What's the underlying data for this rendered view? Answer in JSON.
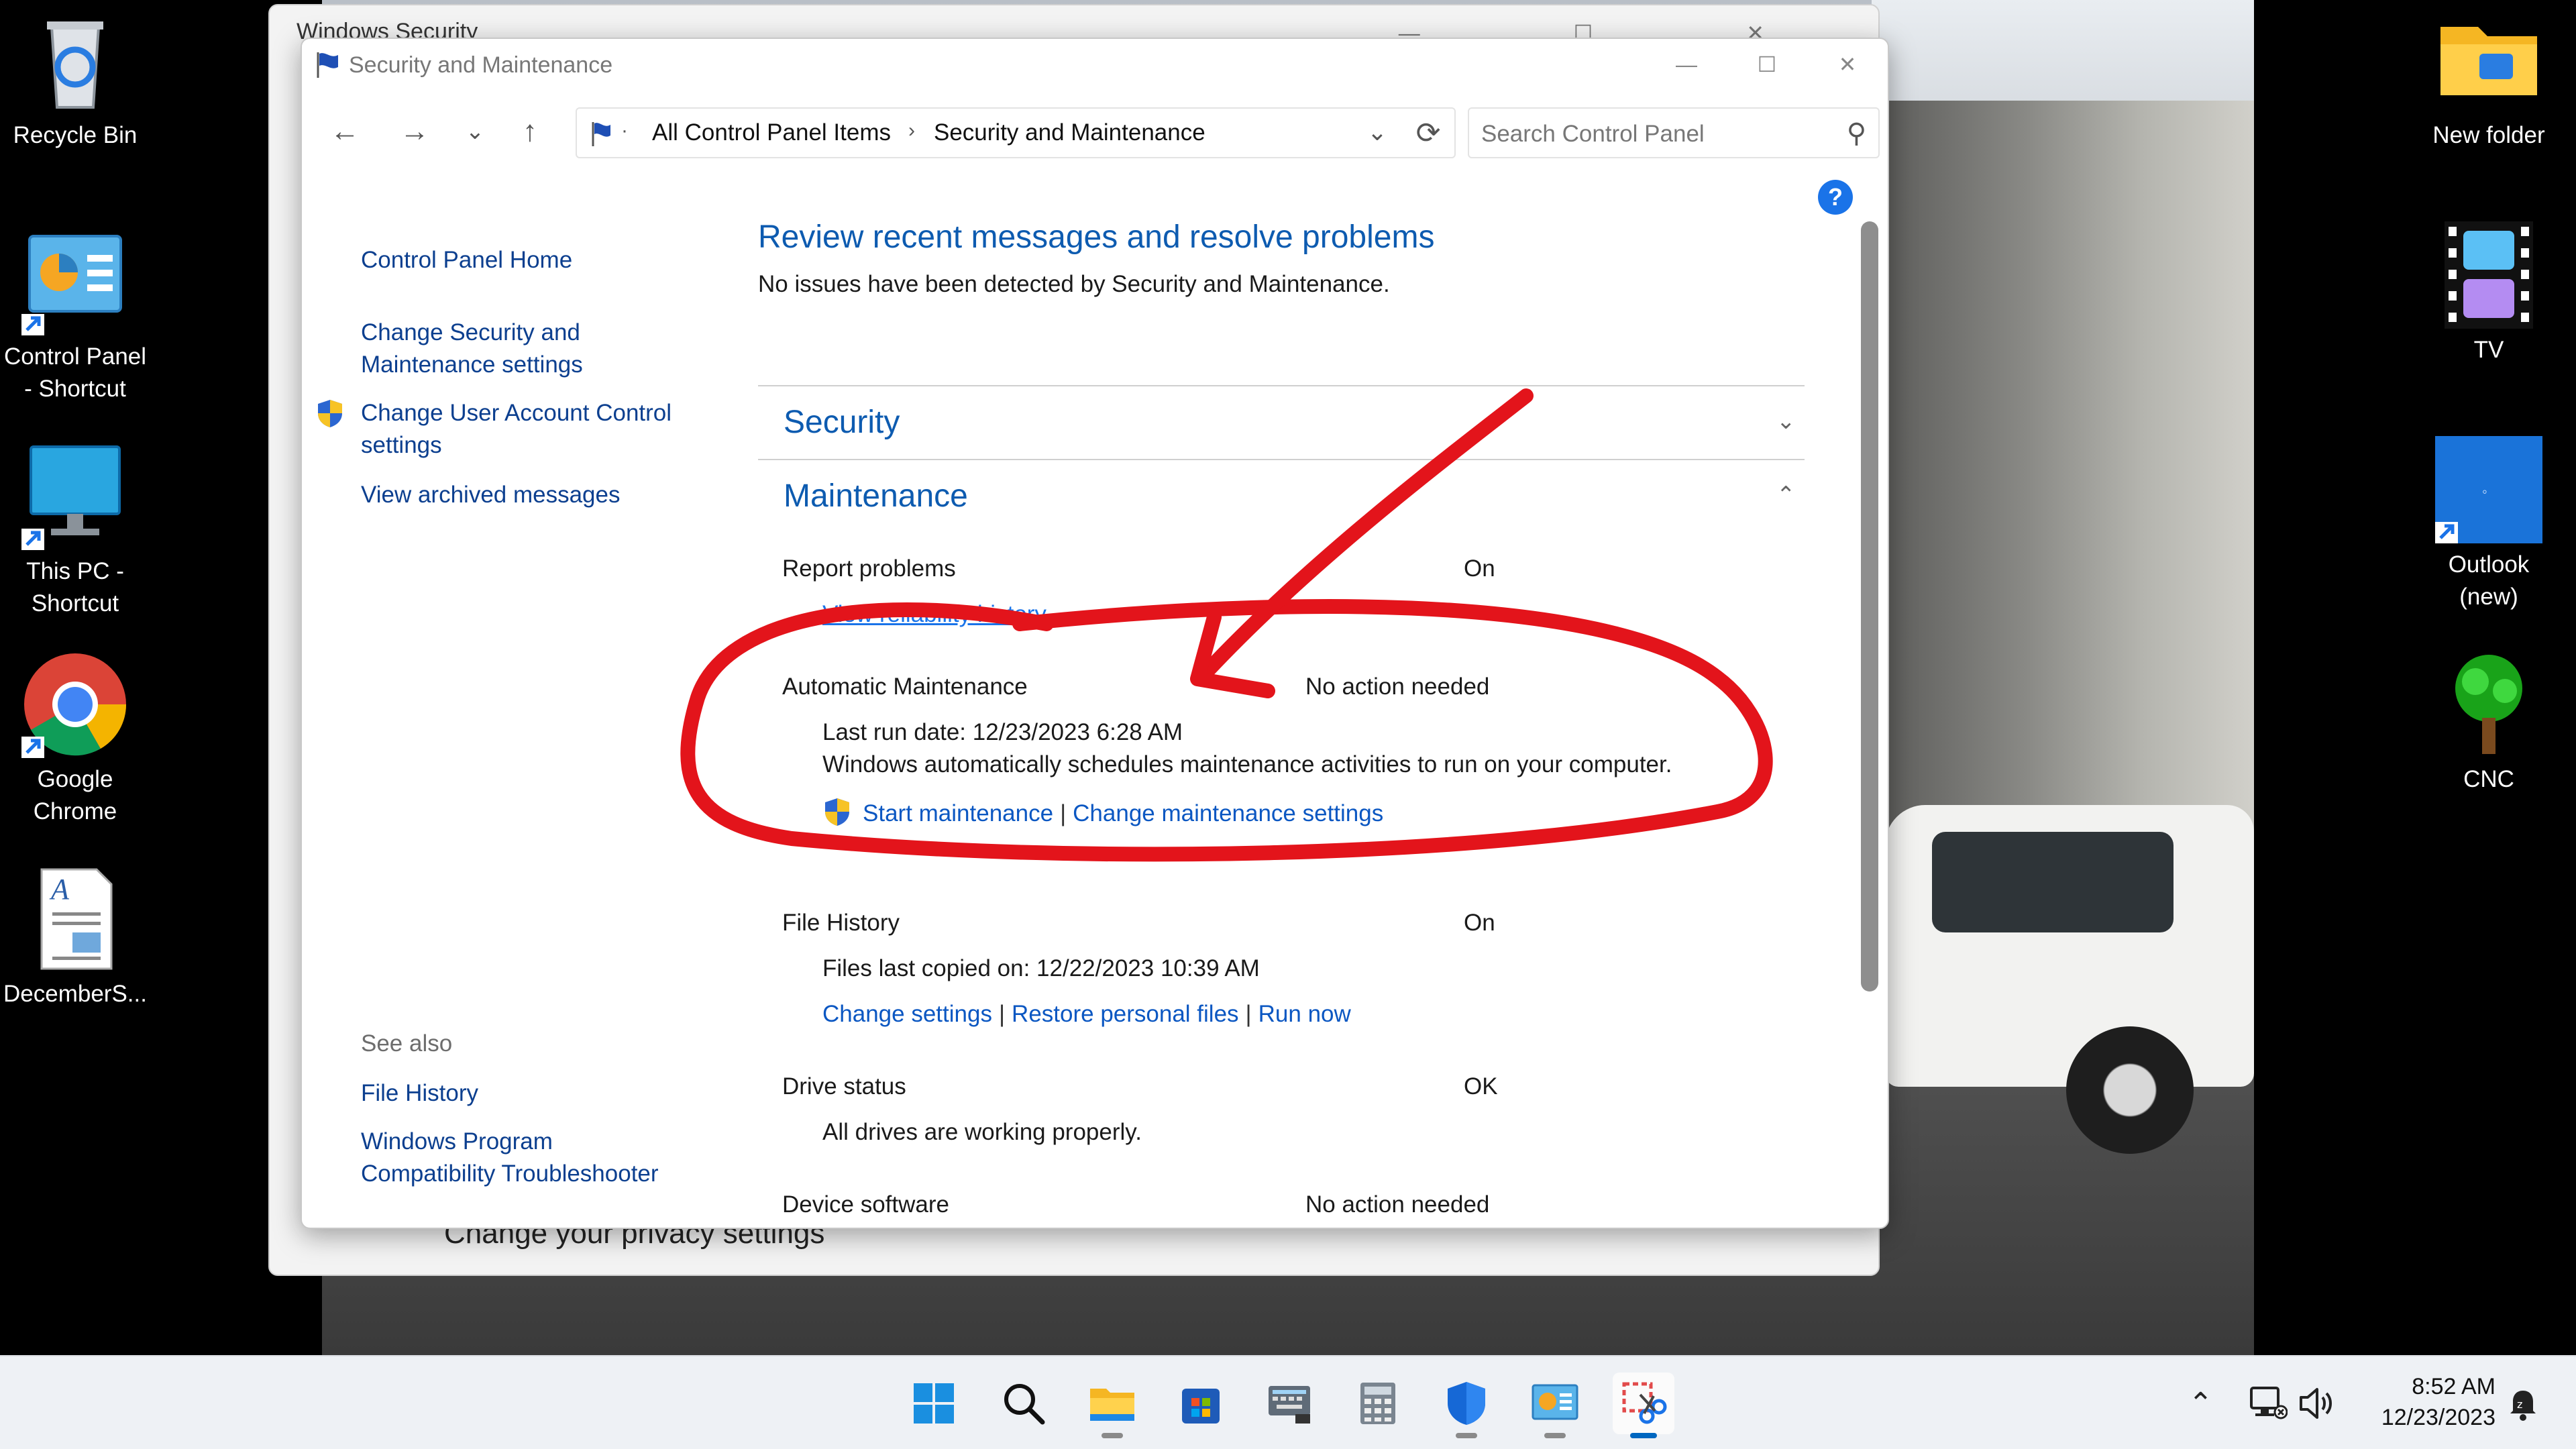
{
  "desktop": {
    "icons_left": [
      {
        "label": "Recycle Bin",
        "icon": "recycle-bin-icon"
      },
      {
        "label": "Control Panel\n- Shortcut",
        "icon": "control-panel-icon"
      },
      {
        "label": "This PC -\nShortcut",
        "icon": "monitor-icon"
      },
      {
        "label": "Google\nChrome",
        "icon": "chrome-icon"
      },
      {
        "label": "DecemberS...",
        "icon": "document-icon"
      }
    ],
    "icons_right": [
      {
        "label": "New folder",
        "icon": "folder-icon"
      },
      {
        "label": "TV",
        "icon": "film-icon"
      },
      {
        "label": "Outlook\n(new)",
        "icon": "outlook-icon"
      },
      {
        "label": "CNC",
        "icon": "tree-icon"
      }
    ]
  },
  "background_window": {
    "title": "Windows Security",
    "bottom_text": "Change your privacy settings"
  },
  "window": {
    "title": "Security and Maintenance",
    "controls": {
      "minimize": "—",
      "maximize": "☐",
      "close": "✕"
    }
  },
  "navbar": {
    "breadcrumbs": [
      "All Control Panel Items",
      "Security and Maintenance"
    ],
    "breadcrumb_sep": "›",
    "search_placeholder": "Search Control Panel"
  },
  "left_pane": {
    "links": [
      "Control Panel Home",
      "Change Security and\nMaintenance settings",
      "Change User Account Control\nsettings",
      "View archived messages"
    ],
    "see_also_header": "See also",
    "see_also": [
      "File History",
      "Windows Program\nCompatibility Troubleshooter"
    ]
  },
  "content": {
    "heading": "Review recent messages and resolve problems",
    "subtitle": "No issues have been detected by Security and Maintenance.",
    "sections": {
      "security": "Security",
      "maintenance": "Maintenance"
    },
    "rows": {
      "report_problems": {
        "label": "Report problems",
        "status": "On",
        "link": "View reliability history"
      },
      "automatic_maintenance": {
        "label": "Automatic Maintenance",
        "status": "No action needed",
        "last_run": "Last run date: 12/23/2023 6:28 AM",
        "description": "Windows automatically schedules maintenance activities to run on your computer.",
        "link_start": "Start maintenance",
        "link_change": "Change maintenance settings"
      },
      "file_history": {
        "label": "File History",
        "status": "On",
        "last_copied": "Files last copied on: 12/22/2023 10:39 AM",
        "link_change": "Change settings",
        "link_restore": "Restore personal files",
        "link_run": "Run now"
      },
      "drive_status": {
        "label": "Drive status",
        "status": "OK",
        "detail": "All drives are working properly."
      },
      "device_software": {
        "label": "Device software",
        "status": "No action needed"
      }
    },
    "help": "?"
  },
  "taskbar": {
    "apps": [
      "start-icon",
      "search-icon",
      "file-explorer-icon",
      "store-icon",
      "keyboard-app-icon",
      "calculator-icon",
      "security-shield-icon",
      "control-panel-icon",
      "snipping-tool-icon"
    ],
    "time": "8:52 AM",
    "date": "12/23/2023"
  },
  "colors": {
    "accent": "#0067c0",
    "heading_blue": "#0d5bb0",
    "annotation_red": "#e3141b"
  }
}
